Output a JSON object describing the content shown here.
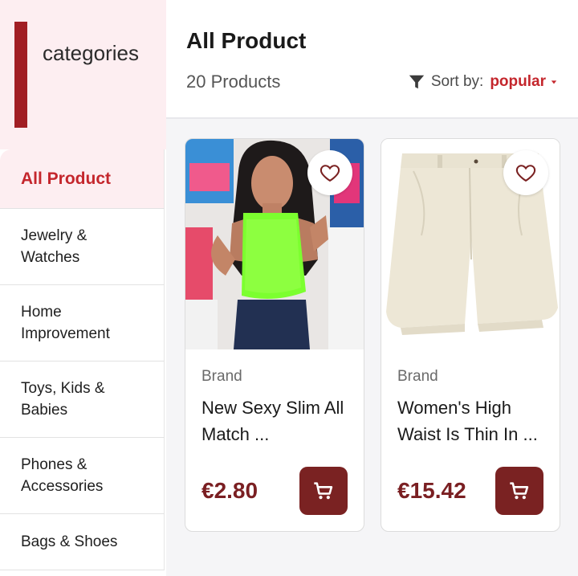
{
  "sidebar": {
    "title": "categories",
    "items": [
      {
        "label": "All Product"
      },
      {
        "label": "Jewelry & Watches"
      },
      {
        "label": "Home Improvement"
      },
      {
        "label": "Toys, Kids & Babies"
      },
      {
        "label": "Phones & Accessories"
      },
      {
        "label": "Bags & Shoes"
      }
    ]
  },
  "header": {
    "title": "All Product",
    "count": "20 Products",
    "sort_label": "Sort by:",
    "sort_value": "popular"
  },
  "products": [
    {
      "brand": "Brand",
      "name": "New Sexy Slim All Match ...",
      "price": "€2.80",
      "image": "woman in neon green halter bodysuit"
    },
    {
      "brand": "Brand",
      "name": "Women's High Waist Is Thin In ...",
      "price": "€15.42",
      "image": "beige high waist shorts"
    }
  ],
  "colors": {
    "accent": "#c4262c",
    "dark_accent": "#7a2222",
    "sidebar_bg": "#fdeef1"
  },
  "icons": {
    "filter": "filter-icon",
    "favorite": "heart-outline-icon",
    "cart": "cart-icon"
  }
}
